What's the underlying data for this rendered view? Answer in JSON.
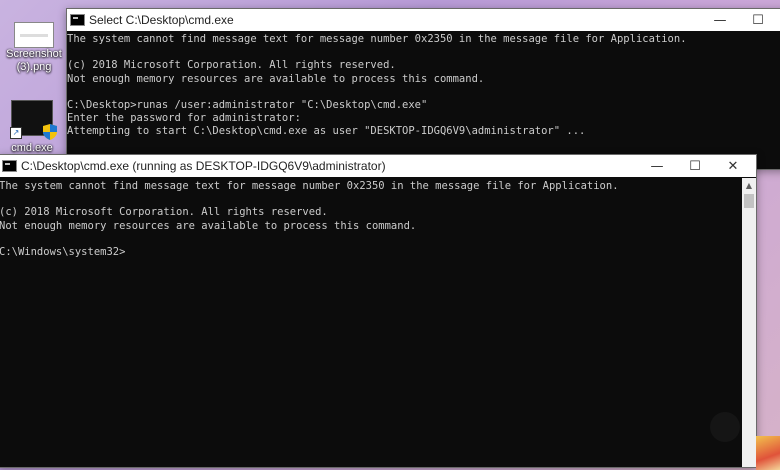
{
  "desktop": {
    "icons": [
      {
        "label_line1": "Screenshot",
        "label_line2": "(3).png"
      },
      {
        "label": "cmd.exe"
      }
    ]
  },
  "window1": {
    "title": "Select C:\\Desktop\\cmd.exe",
    "controls": {
      "minimize": "—",
      "maximize": "☐"
    },
    "lines": [
      "The system cannot find message text for message number 0x2350 in the message file for Application.",
      "",
      "(c) 2018 Microsoft Corporation. All rights reserved.",
      "Not enough memory resources are available to process this command.",
      "",
      "C:\\Desktop>runas /user:administrator \"C:\\Desktop\\cmd.exe\"",
      "Enter the password for administrator:",
      "Attempting to start C:\\Desktop\\cmd.exe as user \"DESKTOP-IDGQ6V9\\administrator\" ..."
    ]
  },
  "window2": {
    "title": "C:\\Desktop\\cmd.exe (running as DESKTOP-IDGQ6V9\\administrator)",
    "controls": {
      "minimize": "—",
      "maximize": "☐",
      "close": "✕"
    },
    "lines": [
      "The system cannot find message text for message number 0x2350 in the message file for Application.",
      "",
      "(c) 2018 Microsoft Corporation. All rights reserved.",
      "Not enough memory resources are available to process this command.",
      "",
      "C:\\Windows\\system32>"
    ],
    "scroll_up": "▲"
  }
}
